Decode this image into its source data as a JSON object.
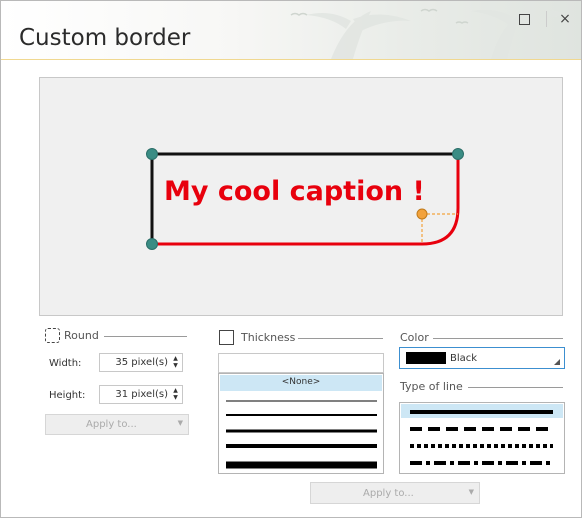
{
  "window": {
    "title": "Custom border"
  },
  "preview": {
    "caption": "My cool caption !"
  },
  "round": {
    "label": "Round",
    "width_label": "Width:",
    "width_value": "35 pixel(s)",
    "height_label": "Height:",
    "height_value": "31 pixel(s)",
    "apply_label": "Apply to..."
  },
  "thickness": {
    "label": "Thickness",
    "input_value": "",
    "none_label": "<None>",
    "options": [
      1,
      2,
      3,
      4,
      5,
      7
    ]
  },
  "color": {
    "label": "Color",
    "selected": "Black",
    "swatch": "#000000"
  },
  "type_of_line": {
    "label": "Type of line",
    "styles": [
      "solid",
      "dashed",
      "dotted",
      "dash-dot"
    ]
  },
  "footer": {
    "apply_label": "Apply to..."
  },
  "colors": {
    "accent": "#e8000d",
    "handle": "#3a8c84",
    "corner": "#f2a23c",
    "selection": "#cde7f5"
  }
}
